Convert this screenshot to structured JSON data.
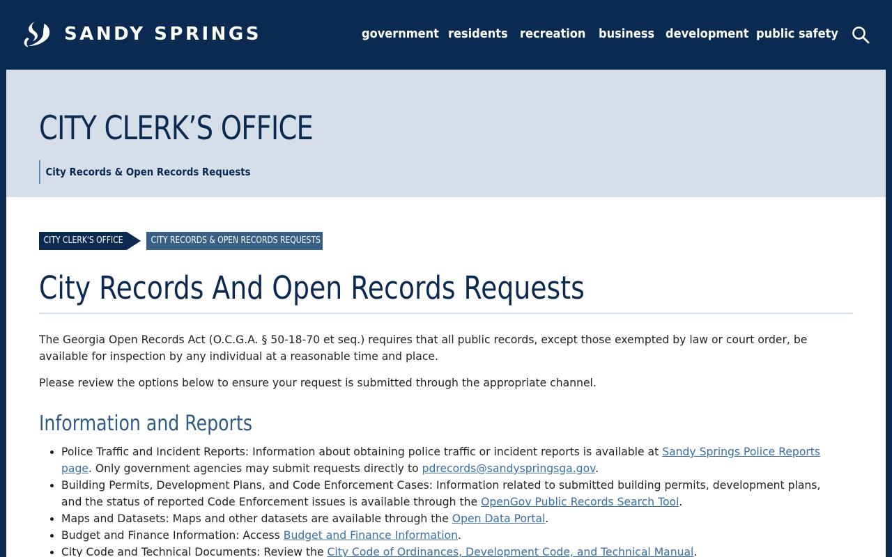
{
  "header": {
    "brand": "SANDY SPRINGS",
    "nav": [
      "government",
      "residents",
      "recreation",
      "business",
      "development",
      "public safety"
    ]
  },
  "hero": {
    "title": "CITY CLERK’S OFFICE",
    "subtitle": "City Records & Open Records Requests"
  },
  "breadcrumb": [
    "CITY CLERK'S OFFICE",
    "CITY RECORDS & OPEN RECORDS REQUESTS"
  ],
  "main": {
    "title": "City Records And Open Records Requests",
    "intro": "The Georgia Open Records Act (O.C.G.A. § 50-18-70 et seq.) requires that all public records, except those exempted by law or court order, be available for inspection by any individual at a reasonable time and place.",
    "review": "Please review the options below to ensure your request is submitted through the appropriate channel.",
    "section_heading": "Information and Reports",
    "items": [
      {
        "text": "Police Traffic and Incident Reports: Information about obtaining police traffic or incident reports is available at ",
        "link1": "Sandy Springs Police Reports page",
        "mid": ". Only government agencies may submit requests directly to ",
        "link2": "pdrecords@sandyspringsga.gov",
        "end": "."
      },
      {
        "text": "Building Permits, Development Plans, and Code Enforcement Cases: Information related to submitted building permits, development plans, and the status of reported Code Enforcement issues is available through the ",
        "link": "OpenGov Public Records Search Tool",
        "end": "."
      },
      {
        "text": "Maps and Datasets: Maps and other datasets are available through the ",
        "link": "Open Data Portal",
        "end": "."
      },
      {
        "text": "Budget and Finance Information: Access ",
        "link": "Budget and Finance Information",
        "end": "."
      },
      {
        "text": "City Code and Technical Documents: Review the ",
        "link": "City Code of Ordinances, Development Code, and Technical Manual",
        "end": "."
      }
    ]
  },
  "colors": {
    "navy": "#0b2a52",
    "hero_bg": "#d6dfe9",
    "breadcrumb_active": "#3a5f85",
    "link": "#3a6ea5",
    "section_heading": "#2f5b86"
  }
}
